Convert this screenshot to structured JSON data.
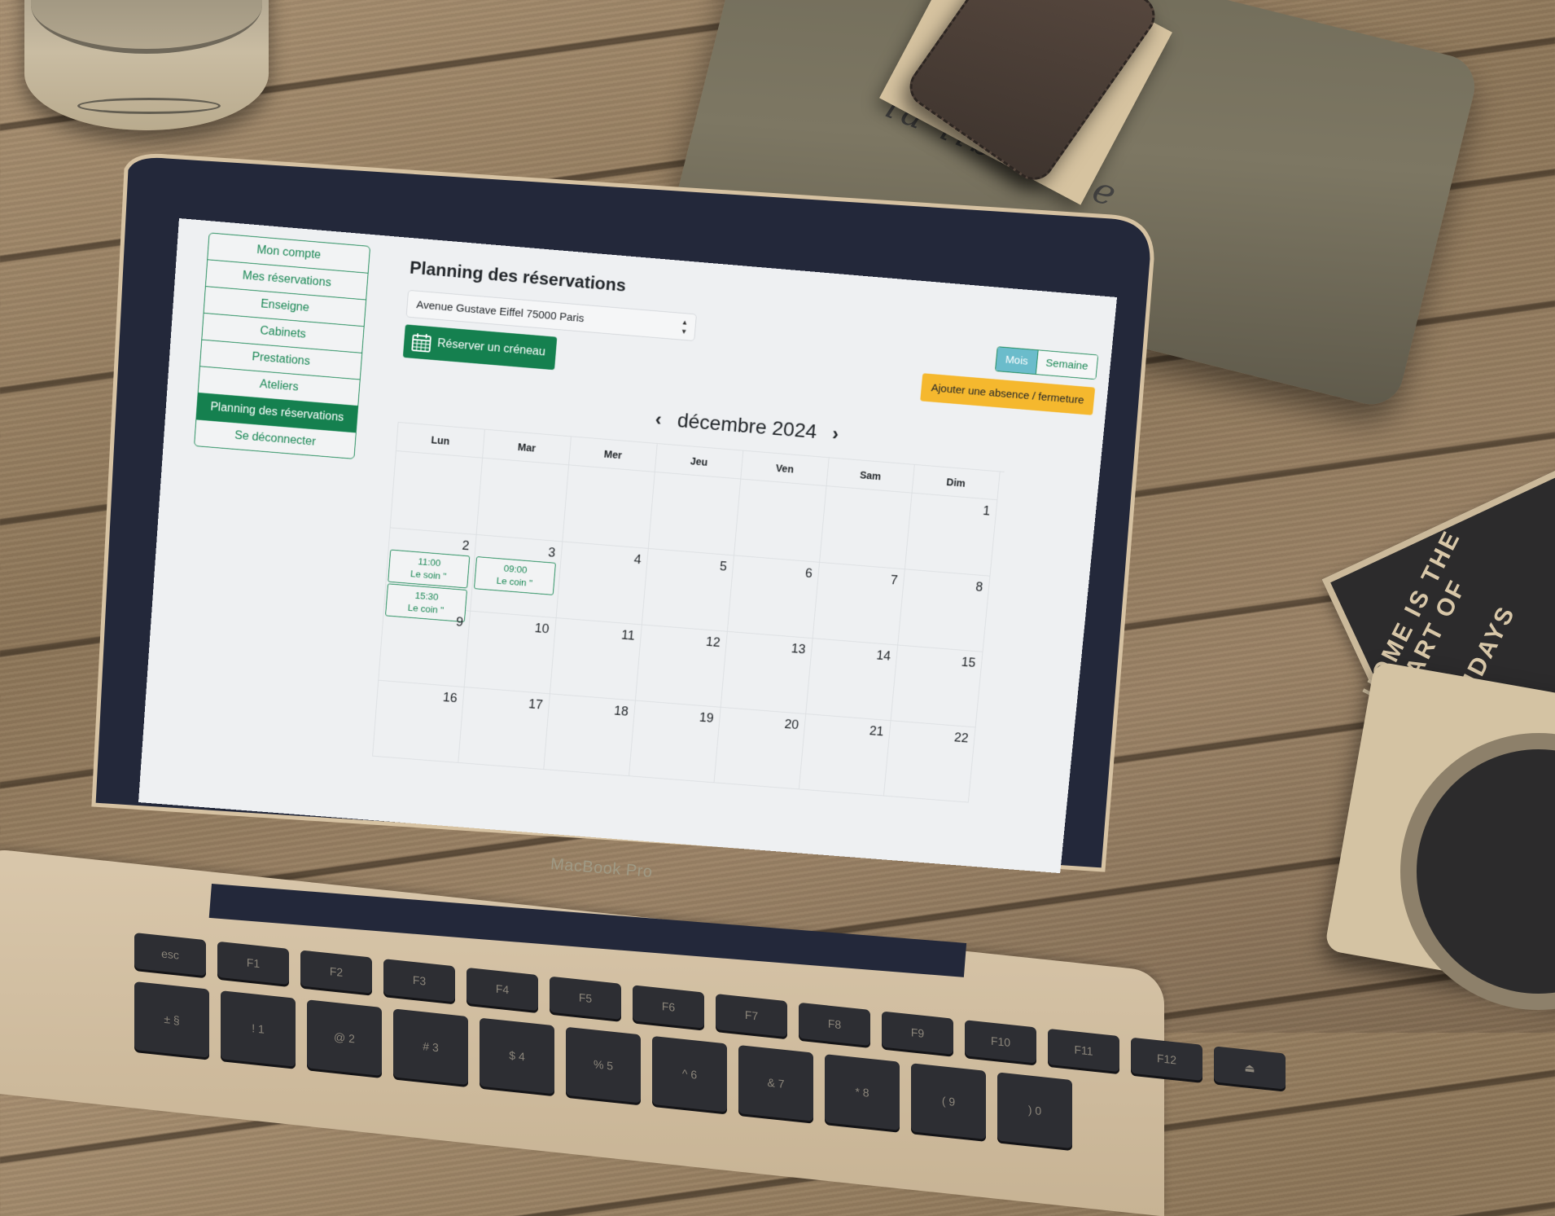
{
  "sidebar": {
    "items": [
      {
        "label": "Mon compte",
        "active": false
      },
      {
        "label": "Mes réservations",
        "active": false
      },
      {
        "label": "Enseigne",
        "active": false
      },
      {
        "label": "Cabinets",
        "active": false
      },
      {
        "label": "Prestations",
        "active": false
      },
      {
        "label": "Ateliers",
        "active": false
      },
      {
        "label": "Planning des réservations",
        "active": true
      },
      {
        "label": "Se déconnecter",
        "active": false
      }
    ]
  },
  "main": {
    "title": "Planning des réservations",
    "location_select": {
      "value": "Avenue Gustave Eiffel 75000 Paris",
      "icon": "sort-caret-icon"
    },
    "book_button": {
      "label": "Réserver un créneau",
      "icon": "calendar-icon"
    },
    "view_toggle": {
      "options": [
        "Mois",
        "Semaine"
      ],
      "selected": "Mois"
    },
    "absence_button": {
      "label": "Ajouter une absence / fermeture"
    },
    "calendar": {
      "month_label": "décembre 2024",
      "prev_icon": "chevron-left-icon",
      "next_icon": "chevron-right-icon",
      "weekdays": [
        "Lun",
        "Mar",
        "Mer",
        "Jeu",
        "Ven",
        "Sam",
        "Dim"
      ],
      "weeks": [
        [
          {
            "day": ""
          },
          {
            "day": ""
          },
          {
            "day": ""
          },
          {
            "day": ""
          },
          {
            "day": ""
          },
          {
            "day": ""
          },
          {
            "day": "1"
          }
        ],
        [
          {
            "day": "2",
            "events": [
              {
                "time": "11:00",
                "title": "Le soin \""
              },
              {
                "time": "15:30",
                "title": "Le coin \""
              }
            ]
          },
          {
            "day": "3",
            "events": [
              {
                "time": "09:00",
                "title": "Le coin \""
              }
            ]
          },
          {
            "day": "4"
          },
          {
            "day": "5"
          },
          {
            "day": "6"
          },
          {
            "day": "7"
          },
          {
            "day": "8"
          }
        ],
        [
          {
            "day": "9"
          },
          {
            "day": "10"
          },
          {
            "day": "11"
          },
          {
            "day": "12"
          },
          {
            "day": "13"
          },
          {
            "day": "14"
          },
          {
            "day": "15"
          }
        ],
        [
          {
            "day": "16"
          },
          {
            "day": "17"
          },
          {
            "day": "18"
          },
          {
            "day": "19"
          },
          {
            "day": "20"
          },
          {
            "day": "21"
          },
          {
            "day": "22"
          }
        ]
      ]
    }
  },
  "device": {
    "brand_label": "MacBook Pro"
  },
  "background": {
    "pouch_text": "la libellule",
    "coaster_text": "HOME IS THE HEART OF THE HOLIDAYS"
  },
  "keyboard": {
    "fn_row": [
      "esc",
      "F1",
      "F2",
      "F3",
      "F4",
      "F5",
      "F6",
      "F7",
      "F8",
      "F9",
      "F10",
      "F11",
      "F12",
      "⏏"
    ],
    "num_row": [
      "± §",
      "! 1",
      "@ 2",
      "# 3",
      "$ 4",
      "% 5",
      "^ 6",
      "& 7",
      "* 8",
      "( 9",
      ") 0"
    ]
  },
  "colors": {
    "accent_green": "#15804f",
    "toggle_active": "#6bbccb",
    "warning": "#f5b82e"
  }
}
